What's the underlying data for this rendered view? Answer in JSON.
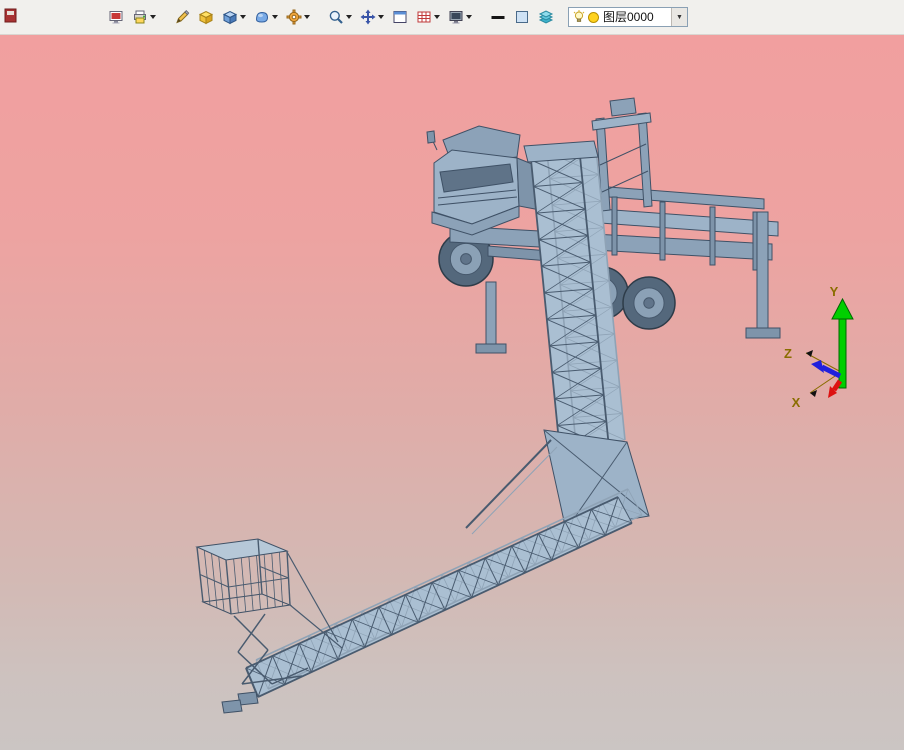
{
  "app": {
    "description": "3D CAD modeling application viewport showing a truck-mounted bridge inspection unit"
  },
  "toolbar": {
    "buttons": [
      {
        "name": "app-icon",
        "dropdown": false
      },
      {
        "name": "display-icon",
        "dropdown": false
      },
      {
        "name": "print-icon",
        "dropdown": true
      },
      {
        "name": "sketch-icon",
        "dropdown": false
      },
      {
        "name": "material-icon",
        "dropdown": false
      },
      {
        "name": "solid-icon",
        "dropdown": true
      },
      {
        "name": "surface-icon",
        "dropdown": true
      },
      {
        "name": "gear-icon",
        "dropdown": true
      },
      {
        "name": "zoom-icon",
        "dropdown": true
      },
      {
        "name": "pan-icon",
        "dropdown": true
      },
      {
        "name": "window-icon",
        "dropdown": false
      },
      {
        "name": "grid-icon",
        "dropdown": true
      },
      {
        "name": "display-mode-icon",
        "dropdown": true
      },
      {
        "name": "line-width-icon",
        "dropdown": false
      },
      {
        "name": "color-swatch-icon",
        "dropdown": false
      },
      {
        "name": "layers-icon",
        "dropdown": false
      }
    ],
    "layer_combo": {
      "value": "图层0000",
      "icons": [
        "light-bulb-icon",
        "layer-color-icon"
      ],
      "layer_color": "#ffd21e"
    }
  },
  "viewport": {
    "background_top": "#f19f9f",
    "background_bottom": "#cbc5c3",
    "model": "truck-mounted bridge inspection unit with lattice tower, truss boom and work basket",
    "model_color": "#9db3c8",
    "axis_triad": {
      "x_label": "X",
      "y_label": "Y",
      "z_label": "Z",
      "x_color": "#dd1111",
      "y_color": "#00cf00",
      "z_color": "#2020dd",
      "label_color": "#8a6d00"
    }
  }
}
